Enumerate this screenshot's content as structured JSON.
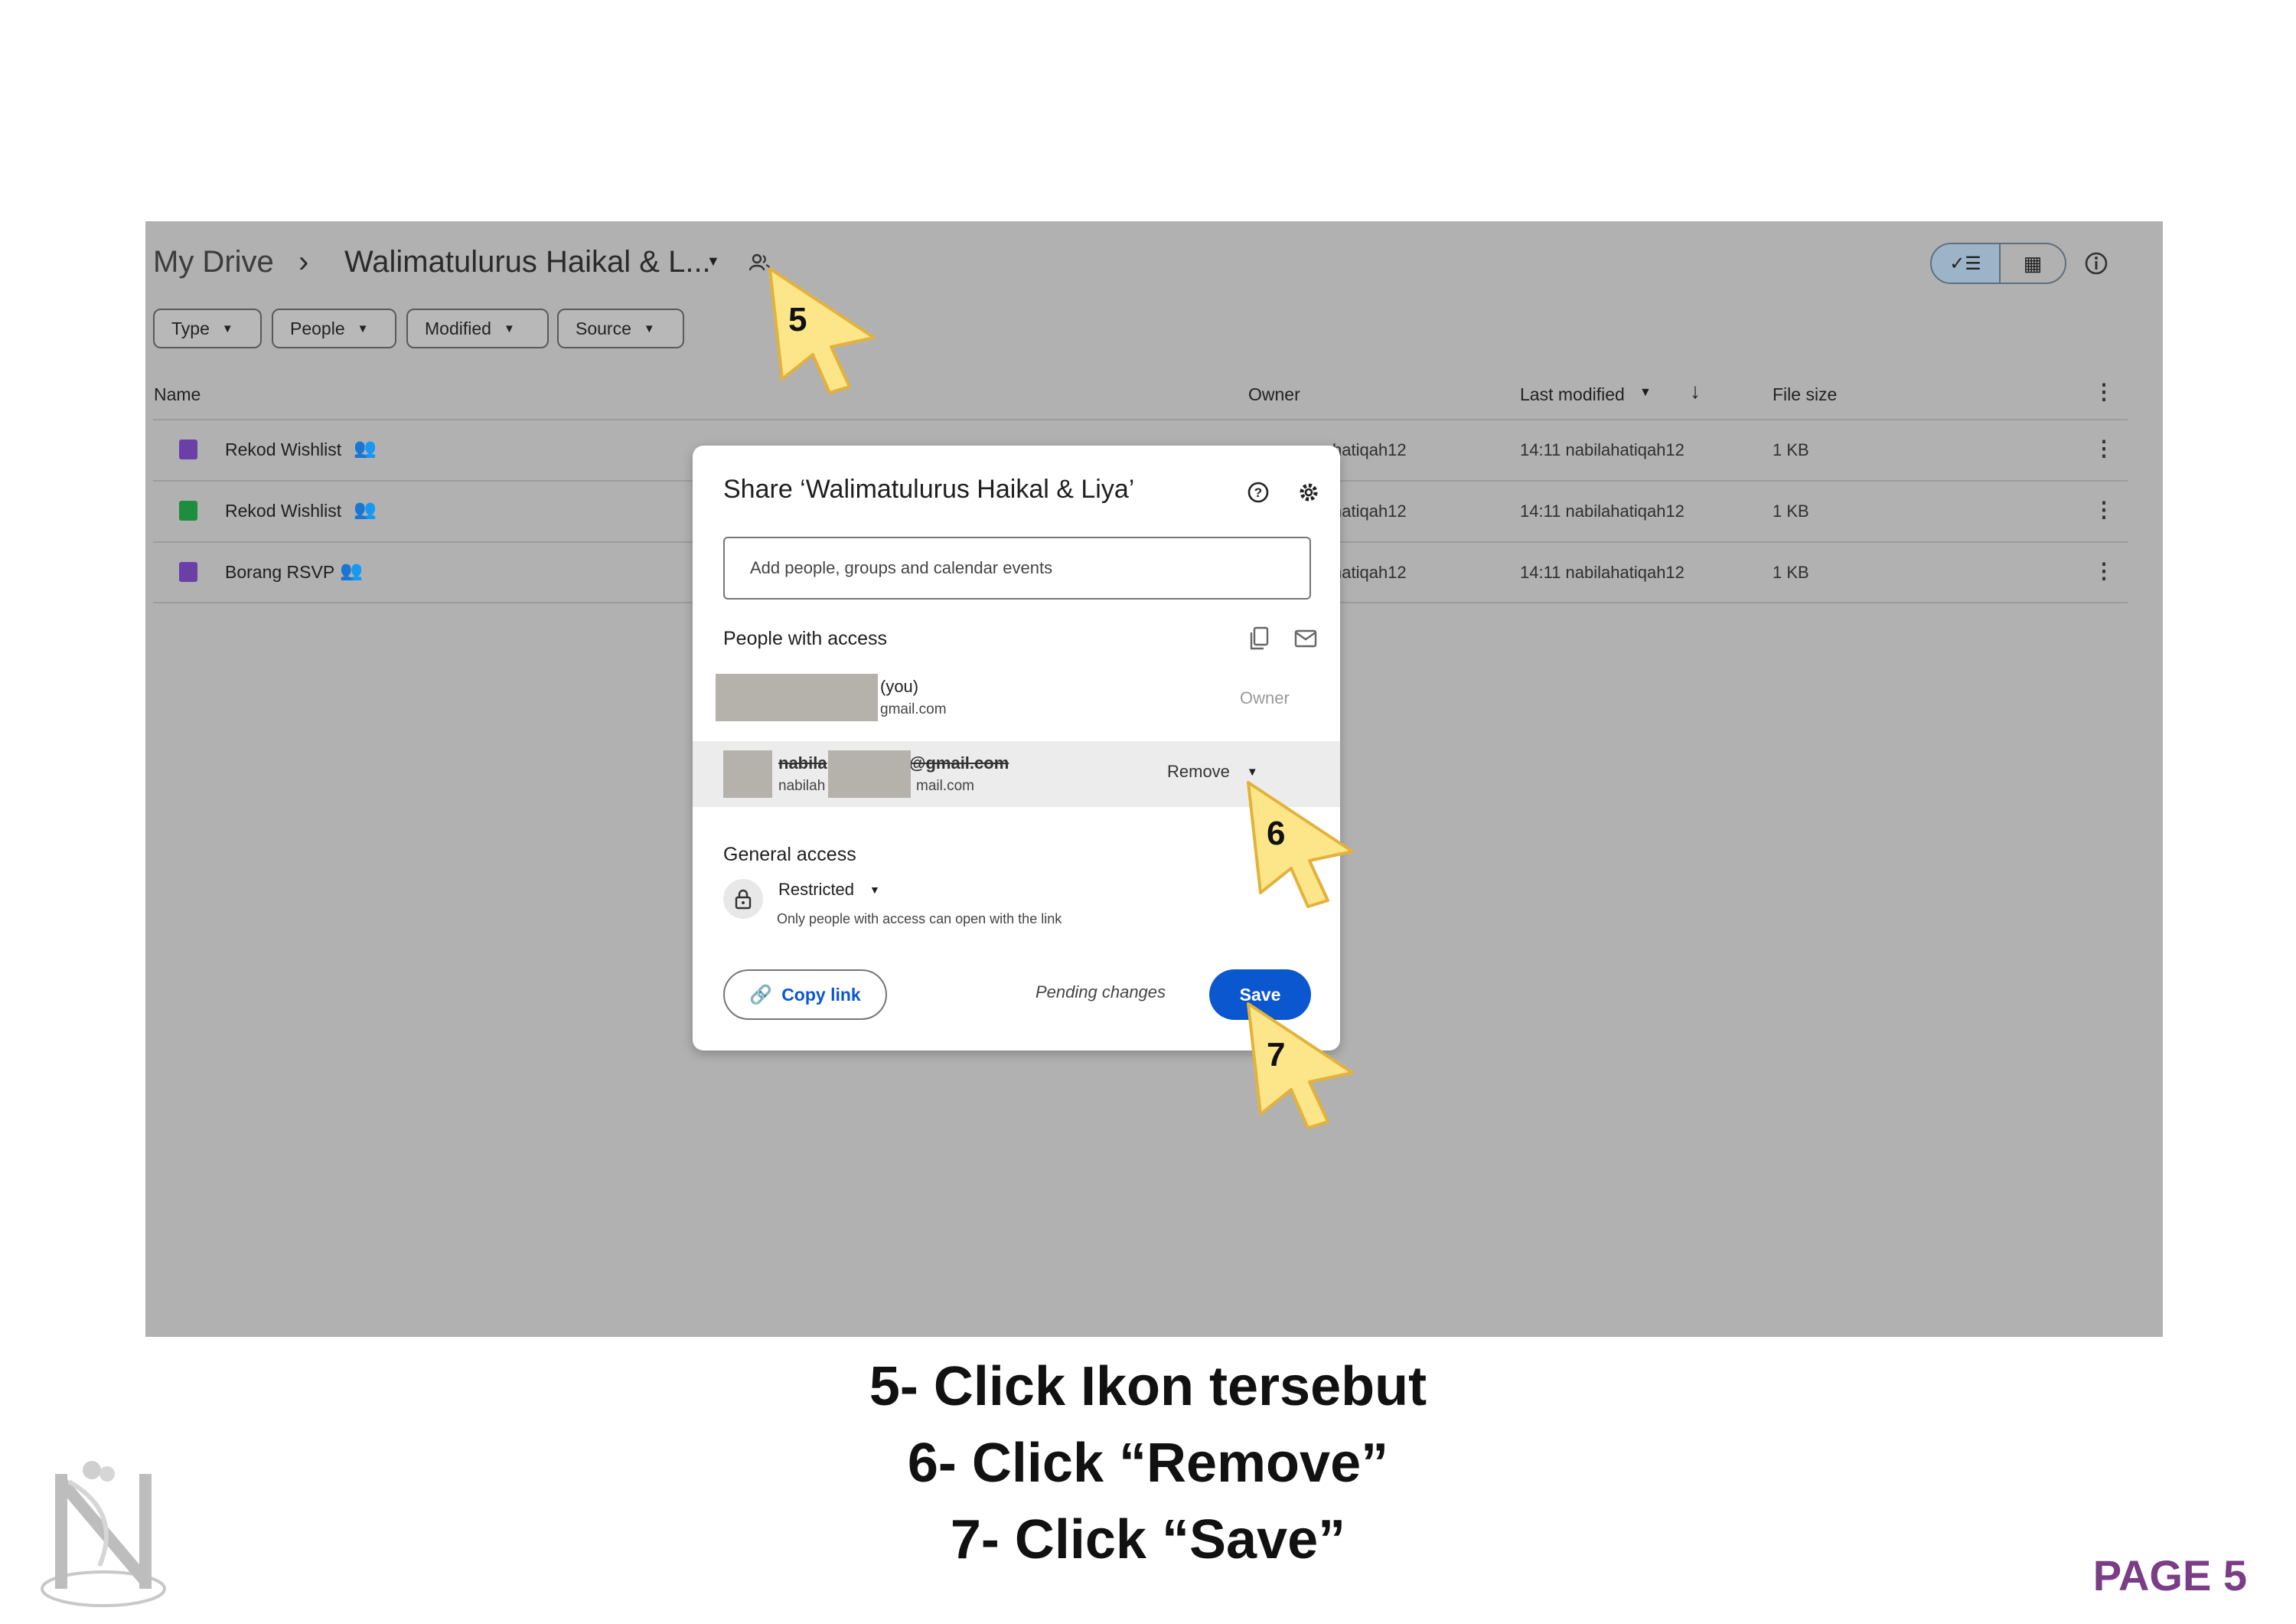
{
  "drive": {
    "breadcrumb_root": "My Drive",
    "breadcrumb_sep": "›",
    "folder_name": "Walimatulurus Haikal & L...",
    "filters": [
      "Type",
      "People",
      "Modified",
      "Source"
    ],
    "columns": {
      "name": "Name",
      "owner": "Owner",
      "last_modified": "Last modified",
      "file_size": "File size"
    },
    "rows": [
      {
        "name": "Rekod Wishlist",
        "icon": "forms-icon",
        "owner": "hatiqah12",
        "modified": "14:11 nabilahatiqah12",
        "size": "1 KB"
      },
      {
        "name": "Rekod Wishlist",
        "icon": "sheets-icon",
        "owner": "hatiqah12",
        "modified": "14:11 nabilahatiqah12",
        "size": "1 KB"
      },
      {
        "name": "Borang RSVP",
        "icon": "forms-icon",
        "owner": "hatiqah12",
        "modified": "14:11 nabilahatiqah12",
        "size": "1 KB"
      }
    ]
  },
  "dialog": {
    "title": "Share ‘Walimatulurus Haikal & Liya’",
    "search_placeholder": "Add people, groups and calendar events",
    "people_with_access": "People with access",
    "person1": {
      "name_suffix": "(you)",
      "email_suffix": "gmail.com",
      "role": "Owner"
    },
    "person2": {
      "name_prefix": "nabila",
      "name_suffix": "@gmail.com",
      "email_prefix": "nabilah",
      "email_suffix": "mail.com",
      "role": "Remove"
    },
    "general_access": "General access",
    "access_level": "Restricted",
    "access_desc": "Only people with access can open with the link",
    "copy_link": "Copy link",
    "pending": "Pending changes",
    "save": "Save"
  },
  "pointers": {
    "p5": "5",
    "p6": "6",
    "p7": "7"
  },
  "instructions": [
    "5- Click Ikon tersebut",
    "6- Click “Remove”",
    "7- Click “Save”"
  ],
  "page_label": "PAGE 5",
  "colors": {
    "overlay": "#b1b1b1",
    "accent": "#0b57d0",
    "page_label": "#7b3e86",
    "pointer": "#fde68a"
  }
}
